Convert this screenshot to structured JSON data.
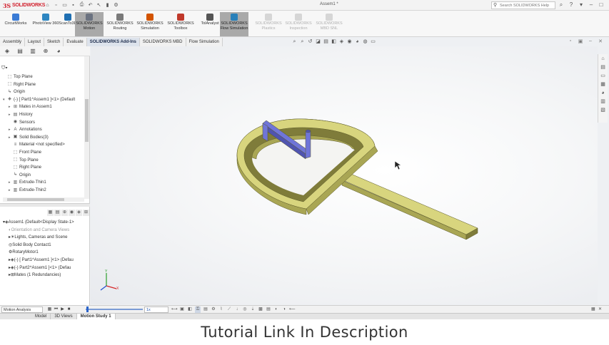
{
  "app": {
    "logo_text": "SOLIDWORKS",
    "logo_mark": "3S",
    "document_title": "Assem1 *",
    "search_placeholder": "Search SOLIDWORKS Help"
  },
  "quick_access_icons": [
    "home-icon",
    "new-icon",
    "open-icon",
    "save-icon",
    "print-icon",
    "undo-icon",
    "select-icon",
    "rebuild-icon",
    "options-icon"
  ],
  "titlebar_right": [
    "search-icon",
    "help-icon",
    "user-icon",
    "minimize-icon",
    "restore-icon",
    "close-icon"
  ],
  "ribbon": {
    "buttons": [
      {
        "label": "CircuitWorks",
        "state": "normal",
        "color": "#3a7bd5"
      },
      {
        "label": "PhotoView 360",
        "state": "normal",
        "color": "#2e86c1"
      },
      {
        "label": "ScanTo3D",
        "state": "normal",
        "color": "#1f6fb2"
      },
      {
        "label": "SOLIDWORKS Motion",
        "state": "active",
        "color": "#6b7280"
      },
      {
        "label": "SOLIDWORKS Routing",
        "state": "normal",
        "color": "#7a7a7a"
      },
      {
        "label": "SOLIDWORKS Simulation",
        "state": "normal",
        "color": "#d35400"
      },
      {
        "label": "SOLIDWORKS Toolbox",
        "state": "normal",
        "color": "#c0392b"
      },
      {
        "label": "TolAnalyst",
        "state": "normal",
        "color": "#555555"
      },
      {
        "label": "SOLIDWORKS Flow Simulation",
        "state": "active",
        "color": "#2980b9"
      },
      {
        "label": "SOLIDWORKS Plastics",
        "state": "disabled",
        "color": "#999999"
      },
      {
        "label": "SOLIDWORKS Inspection",
        "state": "disabled",
        "color": "#999999"
      },
      {
        "label": "SOLIDWORKS MBD SNL",
        "state": "disabled",
        "color": "#999999"
      }
    ]
  },
  "command_tabs": [
    "Assembly",
    "Layout",
    "Sketch",
    "Evaluate",
    "SOLIDWORKS Add-Ins",
    "SOLIDWORKS MBD",
    "Flow Simulation"
  ],
  "active_command_tab": "SOLIDWORKS Add-Ins",
  "feature_tree": {
    "rows": [
      {
        "label": "Top Plane",
        "indent": 0,
        "icon": "plane-icon",
        "expander": ""
      },
      {
        "label": "Right Plane",
        "indent": 0,
        "icon": "plane-icon",
        "expander": ""
      },
      {
        "label": "Origin",
        "indent": 0,
        "icon": "origin-icon",
        "expander": ""
      },
      {
        "label": "(-) [ Part1^Assem1 ]<1> (Default",
        "indent": 0,
        "icon": "part-icon",
        "expander": "▾"
      },
      {
        "label": "Mates in Assem1",
        "indent": 1,
        "icon": "mates-icon",
        "expander": "▸"
      },
      {
        "label": "History",
        "indent": 1,
        "icon": "history-icon",
        "expander": "▸"
      },
      {
        "label": "Sensors",
        "indent": 1,
        "icon": "sensor-icon",
        "expander": ""
      },
      {
        "label": "Annotations",
        "indent": 1,
        "icon": "annotation-icon",
        "expander": "▸"
      },
      {
        "label": "Solid Bodies(3)",
        "indent": 1,
        "icon": "solid-bodies-icon",
        "expander": "▸"
      },
      {
        "label": "Material <not specified>",
        "indent": 1,
        "icon": "material-icon",
        "expander": ""
      },
      {
        "label": "Front Plane",
        "indent": 1,
        "icon": "plane-icon",
        "expander": ""
      },
      {
        "label": "Top Plane",
        "indent": 1,
        "icon": "plane-icon",
        "expander": ""
      },
      {
        "label": "Right Plane",
        "indent": 1,
        "icon": "plane-icon",
        "expander": ""
      },
      {
        "label": "Origin",
        "indent": 1,
        "icon": "origin-icon",
        "expander": ""
      },
      {
        "label": "Extrude-Thin1",
        "indent": 1,
        "icon": "extrude-icon",
        "expander": "▸"
      },
      {
        "label": "Extrude-Thin2",
        "indent": 1,
        "icon": "extrude-icon",
        "expander": "▸"
      }
    ]
  },
  "motion_tree": {
    "rows": [
      {
        "label": "Assem1 (Default<Display State-1>",
        "indent": 0,
        "icon": "assembly-icon",
        "expander": "▾",
        "dim": false
      },
      {
        "label": "Orientation and Camera Views",
        "indent": 1,
        "icon": "camera-icon",
        "expander": "",
        "dim": true
      },
      {
        "label": "Lights, Cameras and Scene",
        "indent": 1,
        "icon": "lights-icon",
        "expander": "▸",
        "dim": false
      },
      {
        "label": "Solid Body Contact1",
        "indent": 1,
        "icon": "contact-icon",
        "expander": "",
        "dim": false
      },
      {
        "label": "RotaryMotor1",
        "indent": 1,
        "icon": "motor-icon",
        "expander": "",
        "dim": false
      },
      {
        "label": "(-) [ Part1^Assem1 ]<1> (Defau",
        "indent": 1,
        "icon": "part-icon",
        "expander": "▸",
        "dim": false
      },
      {
        "label": "(-) Part2^Assem1 ]<1> (Defau",
        "indent": 1,
        "icon": "part-icon",
        "expander": "▸",
        "dim": false
      },
      {
        "label": "Mates (1 Redundancies)",
        "indent": 1,
        "icon": "mates-icon",
        "expander": "▸",
        "dim": false
      }
    ]
  },
  "motion_bar": {
    "study_type": "Motion Analysis",
    "speed_value": "1x",
    "timeline_progress": 0.02
  },
  "bottom_tabs": [
    "Model",
    "3D Views",
    "Motion Study 1"
  ],
  "active_bottom_tab": "Motion Study 1",
  "model_colors": {
    "frame_top": "#d8d57e",
    "frame_side": "#a9a654",
    "frame_dark": "#7f7c3a",
    "link": "#6f75d8",
    "link_dark": "#4f54b0"
  },
  "caption": "Tutorial Link In Description"
}
